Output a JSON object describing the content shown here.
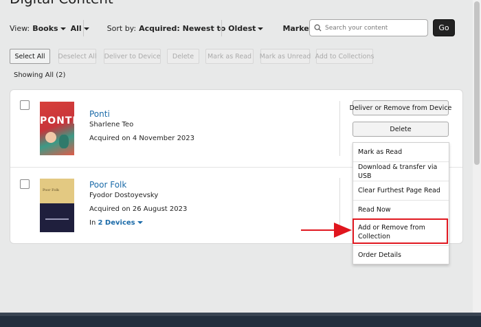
{
  "page": {
    "title": "Digital Content"
  },
  "filters": {
    "view_label": "View:",
    "view_value": "Books",
    "all_value": "All",
    "sort_label": "Sort by:",
    "sort_value": "Acquired: Newest to Oldest",
    "marketplace": "Marketplace orders"
  },
  "search": {
    "placeholder": "Search your content",
    "go_label": "Go"
  },
  "toolbar": {
    "select_all": "Select All",
    "deselect_all": "Deselect All",
    "deliver": "Deliver to Device",
    "delete": "Delete",
    "mark_read": "Mark as Read",
    "mark_unread": "Mark as Unread",
    "add_collections": "Add to Collections"
  },
  "showing": "Showing All (2)",
  "books": [
    {
      "title": "Ponti",
      "author": "Sharlene Teo",
      "acquired": "Acquired on 4 November 2023",
      "cover_text": "PONTI"
    },
    {
      "title": "Poor Folk",
      "author": "Fyodor Dostoyevsky",
      "acquired": "Acquired on 26 August 2023",
      "cover_text": "Poor Folk",
      "devices_prefix": "In",
      "devices_link": "2 Devices"
    }
  ],
  "actions": {
    "deliver_remove": "Deliver or Remove from Device",
    "delete": "Delete"
  },
  "menu": {
    "items": [
      "Mark as Read",
      "Download & transfer via USB",
      "Clear Furthest Page Read",
      "Read Now",
      "Add or Remove from Collection",
      "Order Details"
    ]
  },
  "colors": {
    "link": "#1a6aa8",
    "highlight": "#e0161e",
    "go_button": "#222222",
    "footer": "#232f3e"
  }
}
